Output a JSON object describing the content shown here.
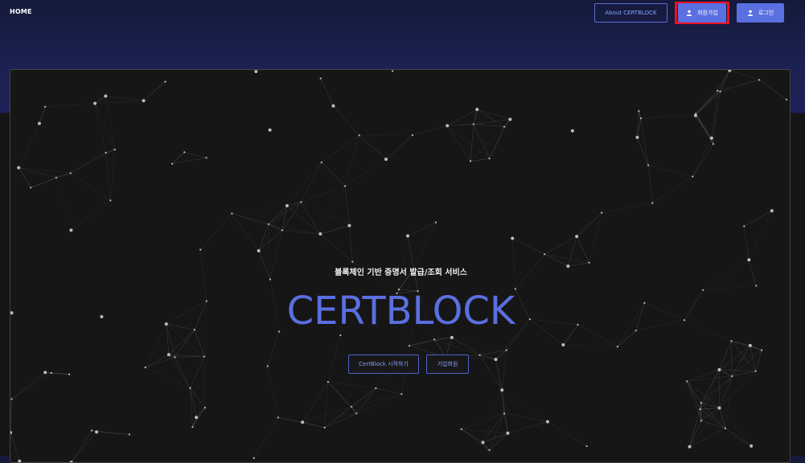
{
  "nav": {
    "home_label": "HOME",
    "about_label": "About CERTBLOCK",
    "join_label": "회원가입",
    "login_label": "로그인",
    "join_icon": "person-icon",
    "login_icon": "person-icon"
  },
  "hero": {
    "subtitle": "블록체인 기반 증명서 발급/조회 서비스",
    "brand": "CERTBLOCK",
    "start_label": "CertBlock 시작하기",
    "corp_label": "기업회원"
  },
  "colors": {
    "accent": "#5a6fe0",
    "highlight_border": "#ee1122",
    "hero_bg": "#161616",
    "header_bg": "#1b2150"
  }
}
